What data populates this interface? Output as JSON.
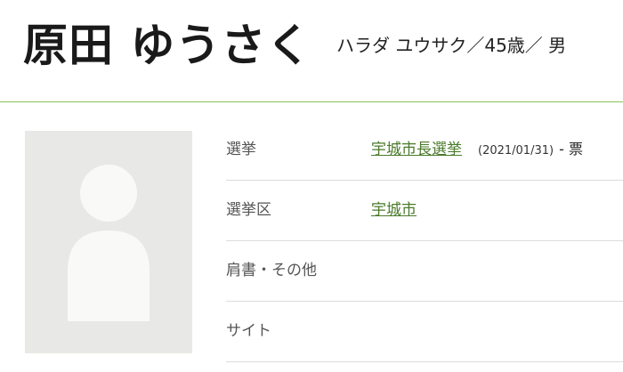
{
  "candidate": {
    "name": "原田 ゆうさく",
    "kana_age_gender": "ハラダ ユウサク／45歳／ 男"
  },
  "photo": {
    "icon": "person-placeholder-icon",
    "bg_color": "#e8e8e6",
    "fg_color": "#f9f9f8"
  },
  "info": {
    "election_label": "選挙",
    "election_value": "宇城市長選挙",
    "election_date": "(2021/01/31)",
    "election_votes": "- 票",
    "district_label": "選挙区",
    "district_value": "宇城市",
    "title_label": "肩書・その他",
    "title_value": "",
    "site_label": "サイト",
    "site_value": ""
  },
  "colors": {
    "accent": "#8bbf5a",
    "link": "#4a7a2a"
  }
}
